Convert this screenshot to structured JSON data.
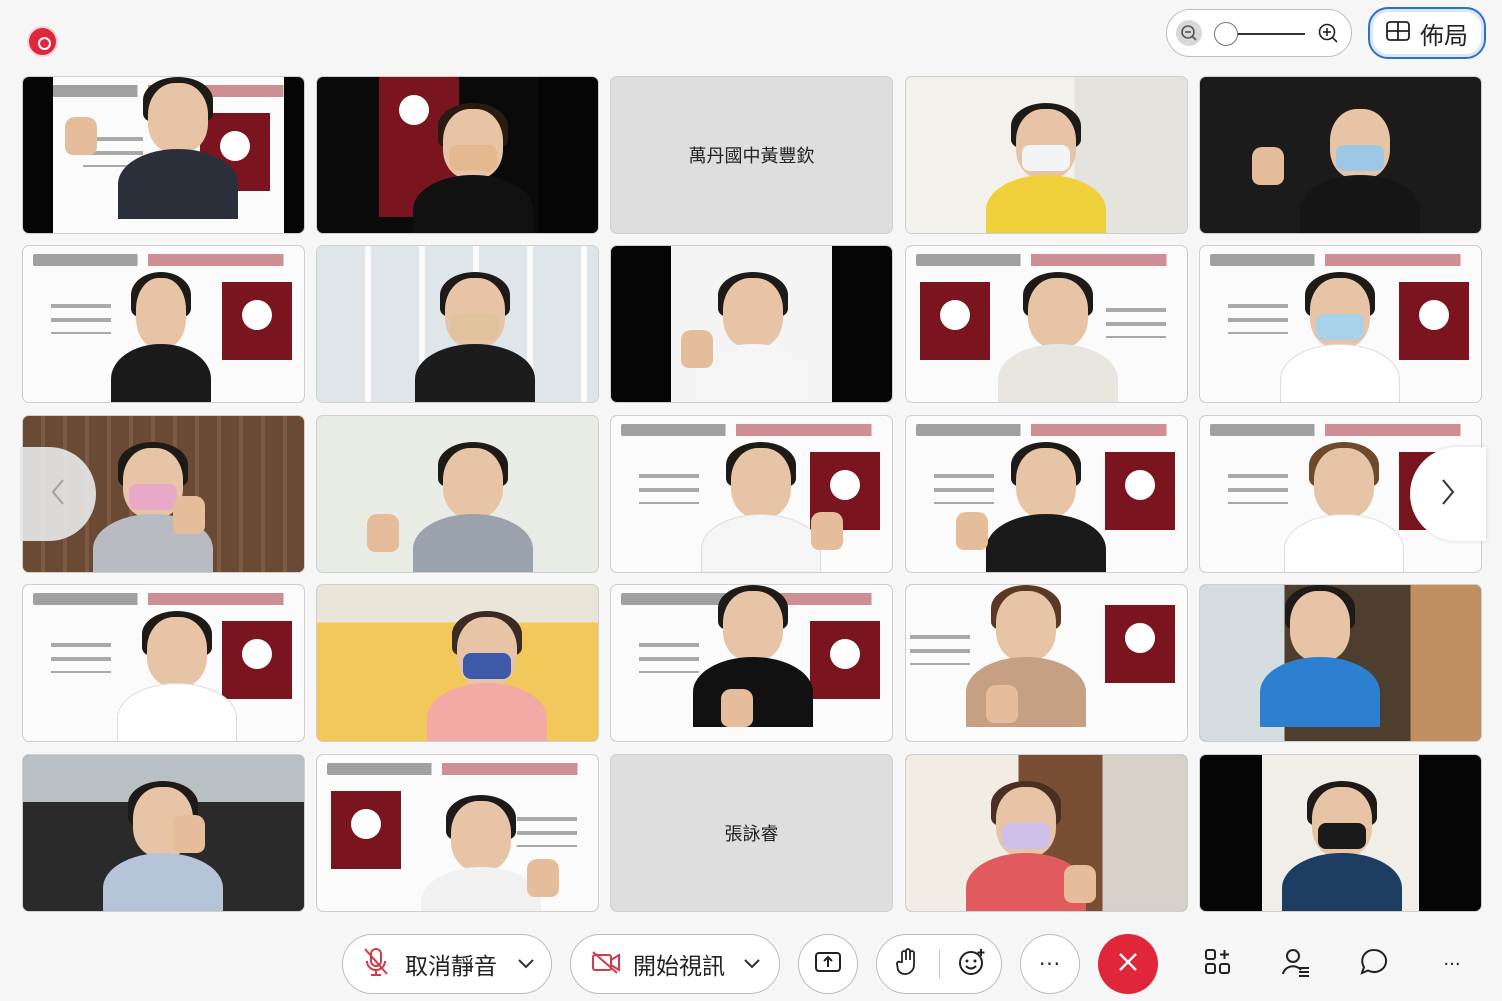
{
  "top": {
    "layout_label": "佈局"
  },
  "participants": [
    {
      "id": "p1",
      "type": "video"
    },
    {
      "id": "p2",
      "type": "video"
    },
    {
      "id": "p3",
      "type": "name",
      "name": "萬丹國中黃豐欽"
    },
    {
      "id": "p4",
      "type": "video"
    },
    {
      "id": "p5",
      "type": "video"
    },
    {
      "id": "p6",
      "type": "video"
    },
    {
      "id": "p7",
      "type": "video"
    },
    {
      "id": "p8",
      "type": "video"
    },
    {
      "id": "p9",
      "type": "video"
    },
    {
      "id": "p10",
      "type": "video"
    },
    {
      "id": "p11",
      "type": "video"
    },
    {
      "id": "p12",
      "type": "video"
    },
    {
      "id": "p13",
      "type": "video"
    },
    {
      "id": "p14",
      "type": "video"
    },
    {
      "id": "p15",
      "type": "video"
    },
    {
      "id": "p16",
      "type": "video"
    },
    {
      "id": "p17",
      "type": "video"
    },
    {
      "id": "p18",
      "type": "video"
    },
    {
      "id": "p19",
      "type": "video"
    },
    {
      "id": "p20",
      "type": "video"
    },
    {
      "id": "p21",
      "type": "video"
    },
    {
      "id": "p22",
      "type": "video"
    },
    {
      "id": "p23",
      "type": "name",
      "name": "張詠睿"
    },
    {
      "id": "p24",
      "type": "video"
    },
    {
      "id": "p25",
      "type": "video"
    }
  ],
  "toolbar": {
    "unmute_label": "取消靜音",
    "start_video_label": "開始視訊",
    "more_label": "···",
    "overflow_label": "···"
  },
  "colors": {
    "accent": "#2f6fc6",
    "danger": "#e0263b",
    "tile_name_bg": "#dedede",
    "slide_logo": "#7a1520"
  },
  "icons": [
    "record-icon",
    "zoom-out-icon",
    "zoom-in-icon",
    "layout-icon",
    "chevron-left-icon",
    "chevron-right-icon",
    "mic-muted-icon",
    "chevron-down-icon",
    "video-off-icon",
    "share-icon",
    "raise-hand-icon",
    "reaction-icon",
    "end-call-icon",
    "apps-icon",
    "participants-icon",
    "chat-icon"
  ]
}
